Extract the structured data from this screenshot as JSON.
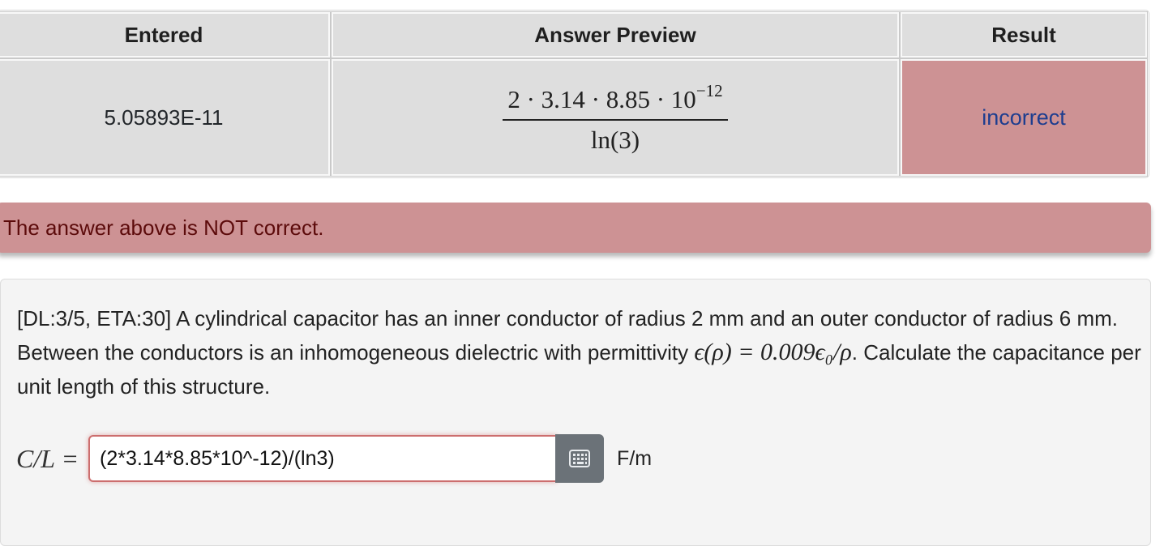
{
  "results_table": {
    "headers": {
      "entered": "Entered",
      "preview": "Answer Preview",
      "result": "Result"
    },
    "row": {
      "entered": "5.05893E-11",
      "preview": {
        "num_main": "2 · 3.14 · 8.85 · 10",
        "num_exp": "−12",
        "den": "ln(3)"
      },
      "result": "incorrect"
    }
  },
  "feedback": {
    "message": "The answer above is NOT correct."
  },
  "problem": {
    "text_before": "[DL:3/5, ETA:30] A cylindrical capacitor has an inner conductor of radius 2 mm and an outer conductor of radius 6 mm. Between the conductors is an inhomogeneous dielectric with permittivity ",
    "math_permittivity": "ϵ(ρ) = 0.009ϵ₀/ρ",
    "text_after": ". Calculate the capacitance per unit length of this structure."
  },
  "answer": {
    "lhs": "C/L =",
    "value": "(2*3.14*8.85*10^-12)/(ln3)",
    "units": "F/m",
    "keyboard_icon": "keyboard-icon"
  },
  "colors": {
    "incorrect_bg": "#cd9294",
    "header_bg": "#dedede",
    "link_blue": "#1d3d8f"
  }
}
